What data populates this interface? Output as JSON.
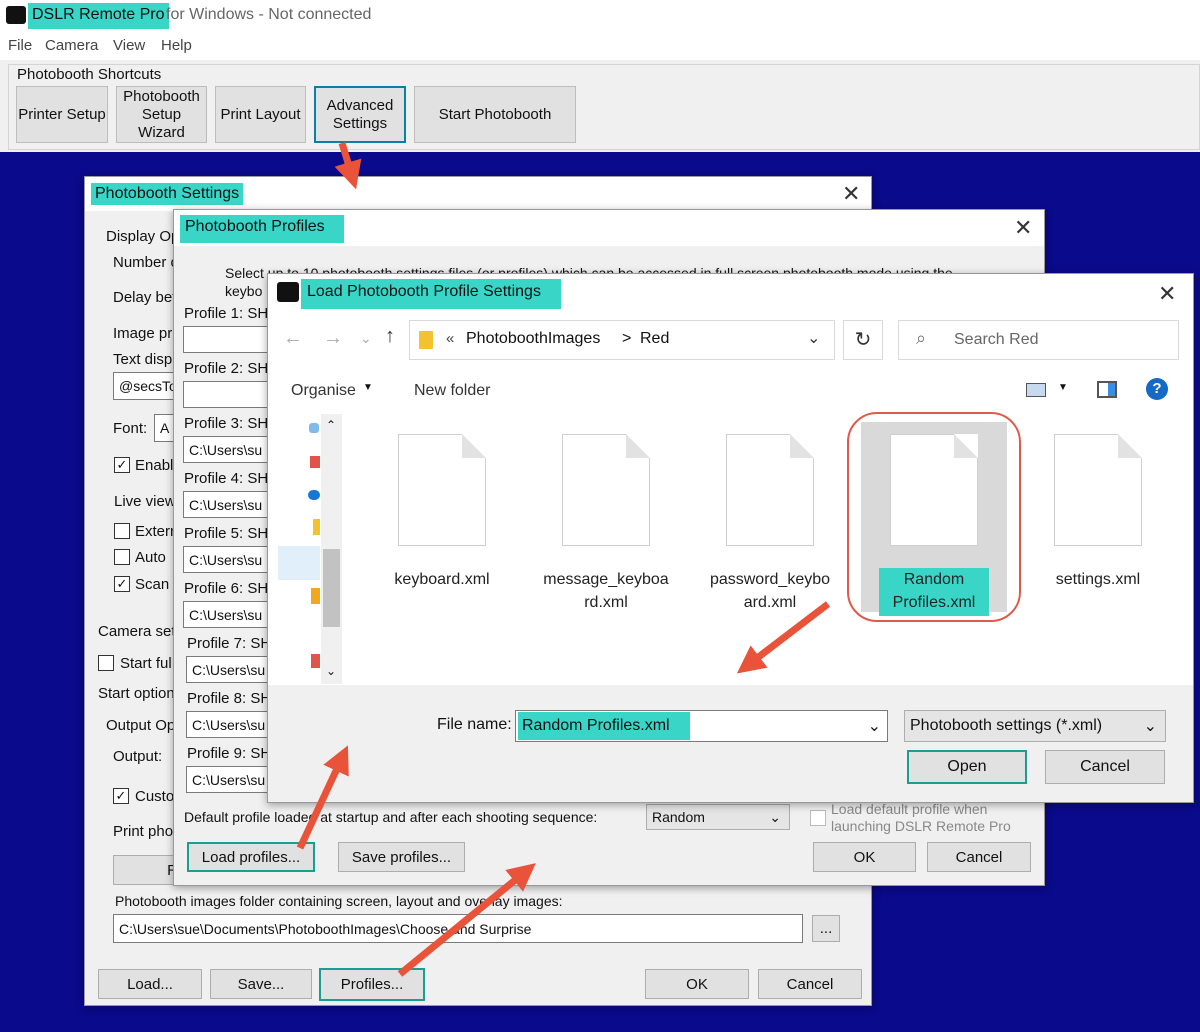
{
  "app": {
    "title_main": "DSLR Remote Pro",
    "title_rest": "for Windows - Not connected",
    "menu": [
      "File",
      "Camera",
      "View",
      "Help"
    ]
  },
  "shortcuts": {
    "label": "Photobooth Shortcuts",
    "buttons": [
      "Printer Setup",
      "Photobooth Setup Wizard",
      "Print Layout",
      "Advanced Settings",
      "Start Photobooth"
    ]
  },
  "settings_dialog": {
    "title": "Photobooth Settings",
    "labels": [
      "Display Op",
      "Number o",
      "Delay bef",
      "Image pr",
      "Text disp",
      "Font:",
      "Enable",
      "Live view",
      "Extern",
      "Auto",
      "Scan",
      "Camera set",
      "Start ful",
      "Start option",
      "Output Op",
      "Output:",
      "Custo",
      "Print pho"
    ],
    "text_field": "@secsTo",
    "font_field": "A",
    "folder_label": "Photobooth images folder containing screen, layout and overlay images:",
    "folder_path": "C:\\Users\\sue\\Documents\\PhotoboothImages\\Choose and Surprise",
    "browse": "...",
    "buttons": {
      "load": "Load...",
      "save": "Save...",
      "profiles": "Profiles...",
      "ok": "OK",
      "cancel": "Cancel"
    },
    "r_button": "R"
  },
  "profiles_dialog": {
    "title": "Photobooth Profiles",
    "desc": "Select up to 10 photobooth settings files (or profiles) which can be accessed in full screen photobooth mode using the",
    "desc2": "keybo",
    "profiles": [
      {
        "label": "Profile 1: SH",
        "value": ""
      },
      {
        "label": "Profile 2: SH",
        "value": ""
      },
      {
        "label": "Profile 3: SH",
        "value": "C:\\Users\\su"
      },
      {
        "label": "Profile 4: SH",
        "value": "C:\\Users\\su"
      },
      {
        "label": "Profile 5: SH",
        "value": "C:\\Users\\su"
      },
      {
        "label": "Profile 6: SH",
        "value": "C:\\Users\\su"
      },
      {
        "label": "Profile 7: SH",
        "value": "C:\\Users\\su"
      },
      {
        "label": "Profile 8: SH",
        "value": "C:\\Users\\su"
      },
      {
        "label": "Profile 9: SH",
        "value": "C:\\Users\\su"
      }
    ],
    "default_label": "Default profile loaded at startup and after each shooting sequence:",
    "default_value": "Random",
    "load_default_label": "Load default profile when launching DSLR Remote Pro",
    "buttons": {
      "load": "Load profiles...",
      "save": "Save profiles...",
      "ok": "OK",
      "cancel": "Cancel"
    }
  },
  "load_dialog": {
    "title": "Load Photobooth Profile Settings",
    "breadcrumb": [
      "«",
      "PhotoboothImages",
      ">",
      "Red"
    ],
    "search_placeholder": "Search Red",
    "organise": "Organise",
    "new_folder": "New folder",
    "files": [
      {
        "name1": "keyboard.xml",
        "name2": ""
      },
      {
        "name1": "message_keyboa",
        "name2": "rd.xml"
      },
      {
        "name1": "password_keybo",
        "name2": "ard.xml"
      },
      {
        "name1": "Random",
        "name2": "Profiles.xml"
      },
      {
        "name1": "settings.xml",
        "name2": ""
      }
    ],
    "filename_label": "File name:",
    "filename_value": "Random Profiles.xml",
    "filetype": "Photobooth settings (*.xml)",
    "open": "Open",
    "cancel": "Cancel"
  },
  "colors": {
    "highlight": "#39d6c8",
    "arrow": "#e8533a",
    "background": "#0a0a8c"
  }
}
